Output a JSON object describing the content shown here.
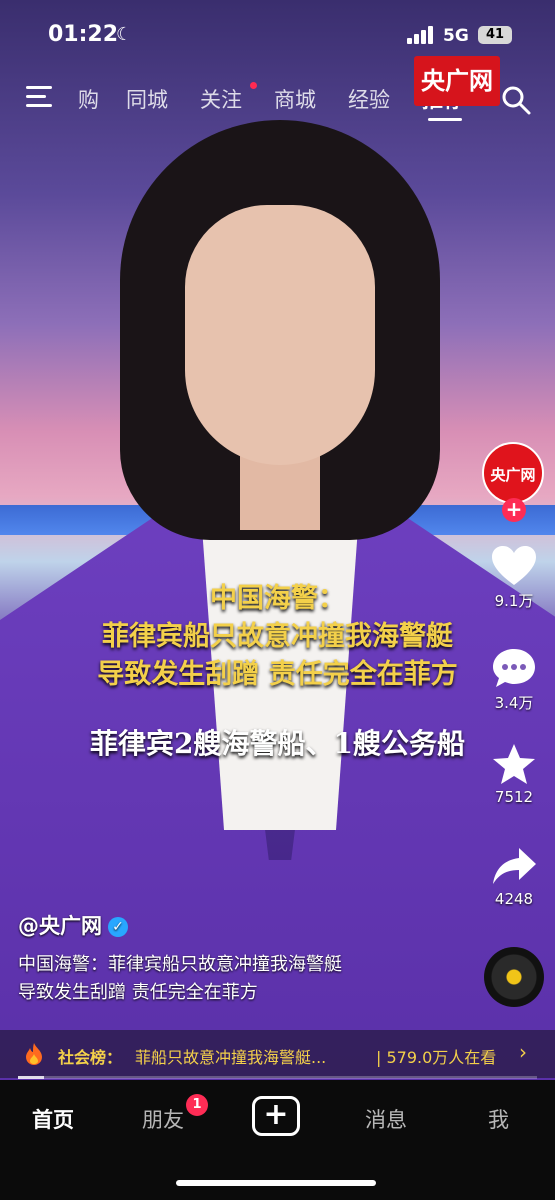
{
  "status": {
    "time": "01:22",
    "network": "5G",
    "battery": "41"
  },
  "top_nav": {
    "tabs": [
      "购",
      "同城",
      "关注",
      "商城",
      "经验",
      "推荐"
    ],
    "active_tab": "推荐",
    "has_follow_dot": true
  },
  "video": {
    "channel_logo": "央广网",
    "caption": {
      "line1": "中国海警：",
      "line2": "菲律宾船只故意冲撞我海警艇",
      "line3": "导致发生刮蹭 责任完全在菲方",
      "line4": "菲律宾2艘海警船、1艘公务船"
    },
    "progress": 0.05
  },
  "side_actions": {
    "avatar_text": "央广网",
    "likes": "9.1万",
    "comments": "3.4万",
    "favorites": "7512",
    "shares": "4248"
  },
  "post": {
    "author": "@央广网",
    "description_line1": "中国海警：菲律宾船只故意冲撞我海警艇",
    "description_line2": "导致发生刮蹭 责任完全在菲方"
  },
  "hot_bar": {
    "tag": "社会榜：",
    "title": "菲船只故意冲撞我海警艇...",
    "viewers": "| 579.0万人在看"
  },
  "bottom_nav": {
    "home": "首页",
    "friends": "朋友",
    "friends_badge": "1",
    "messages": "消息",
    "me": "我"
  },
  "colors": {
    "accent_red": "#fe2c55",
    "caption_yellow": "#f3d04a",
    "verify_blue": "#28a7ff"
  }
}
